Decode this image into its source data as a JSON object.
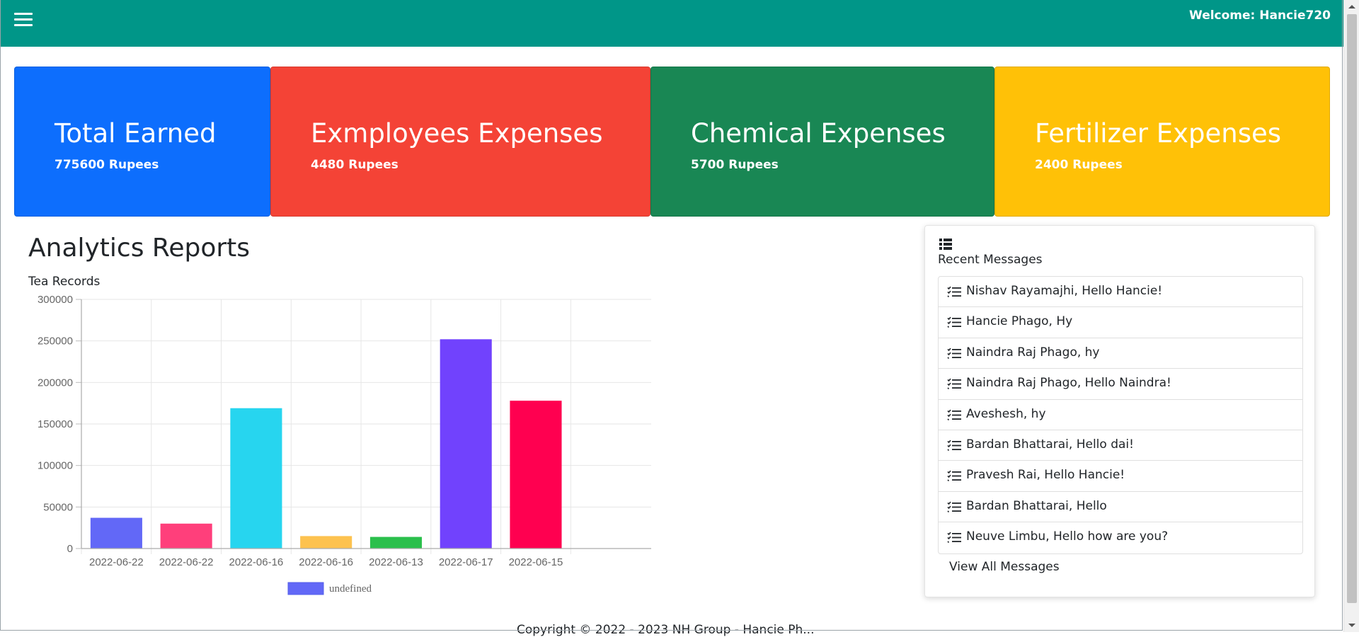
{
  "header": {
    "welcome": "Welcome: Hancie720",
    "bg_color": "#009688"
  },
  "cards": [
    {
      "title": "Total Earned",
      "value": "775600 Rupees",
      "color": "#0d6efd"
    },
    {
      "title": "Exmployees Expenses",
      "value": "4480 Rupees",
      "color": "#f44336"
    },
    {
      "title": "Chemical Expenses",
      "value": "5700 Rupees",
      "color": "#198754"
    },
    {
      "title": "Fertilizer Expenses",
      "value": "2400 Rupees",
      "color": "#ffc107"
    }
  ],
  "analytics": {
    "title": "Analytics Reports",
    "chart_title": "Tea Records"
  },
  "chart_data": {
    "type": "bar",
    "categories": [
      "2022-06-22",
      "2022-06-22",
      "2022-06-16",
      "2022-06-16",
      "2022-06-13",
      "2022-06-17",
      "2022-06-15"
    ],
    "values": [
      37000,
      30000,
      169000,
      15000,
      14000,
      252000,
      178000
    ],
    "bar_colors": [
      "#6268f7",
      "#ff3f7b",
      "#27d5ef",
      "#fdc24f",
      "#2bbf4c",
      "#7142fd",
      "#ff0050"
    ],
    "yticks": [
      0,
      50000,
      100000,
      150000,
      200000,
      250000,
      300000
    ],
    "ylim": [
      0,
      300000
    ],
    "legend": "undefined",
    "grid": true
  },
  "messages": {
    "heading": "Recent Messages",
    "items": [
      "Nishav Rayamajhi, Hello Hancie!",
      "Hancie Phago, Hy",
      "Naindra Raj Phago, hy",
      "Naindra Raj Phago, Hello Naindra!",
      "Aveshesh, hy",
      "Bardan Bhattarai, Hello dai!",
      "Pravesh Rai, Hello Hancie!",
      "Bardan Bhattarai, Hello",
      "Neuve Limbu, Hello how are you?"
    ],
    "view_all": "View All Messages"
  },
  "footer": {
    "text": "Copyright © 2022 - 2023 NH Group - Hancie Ph..."
  }
}
